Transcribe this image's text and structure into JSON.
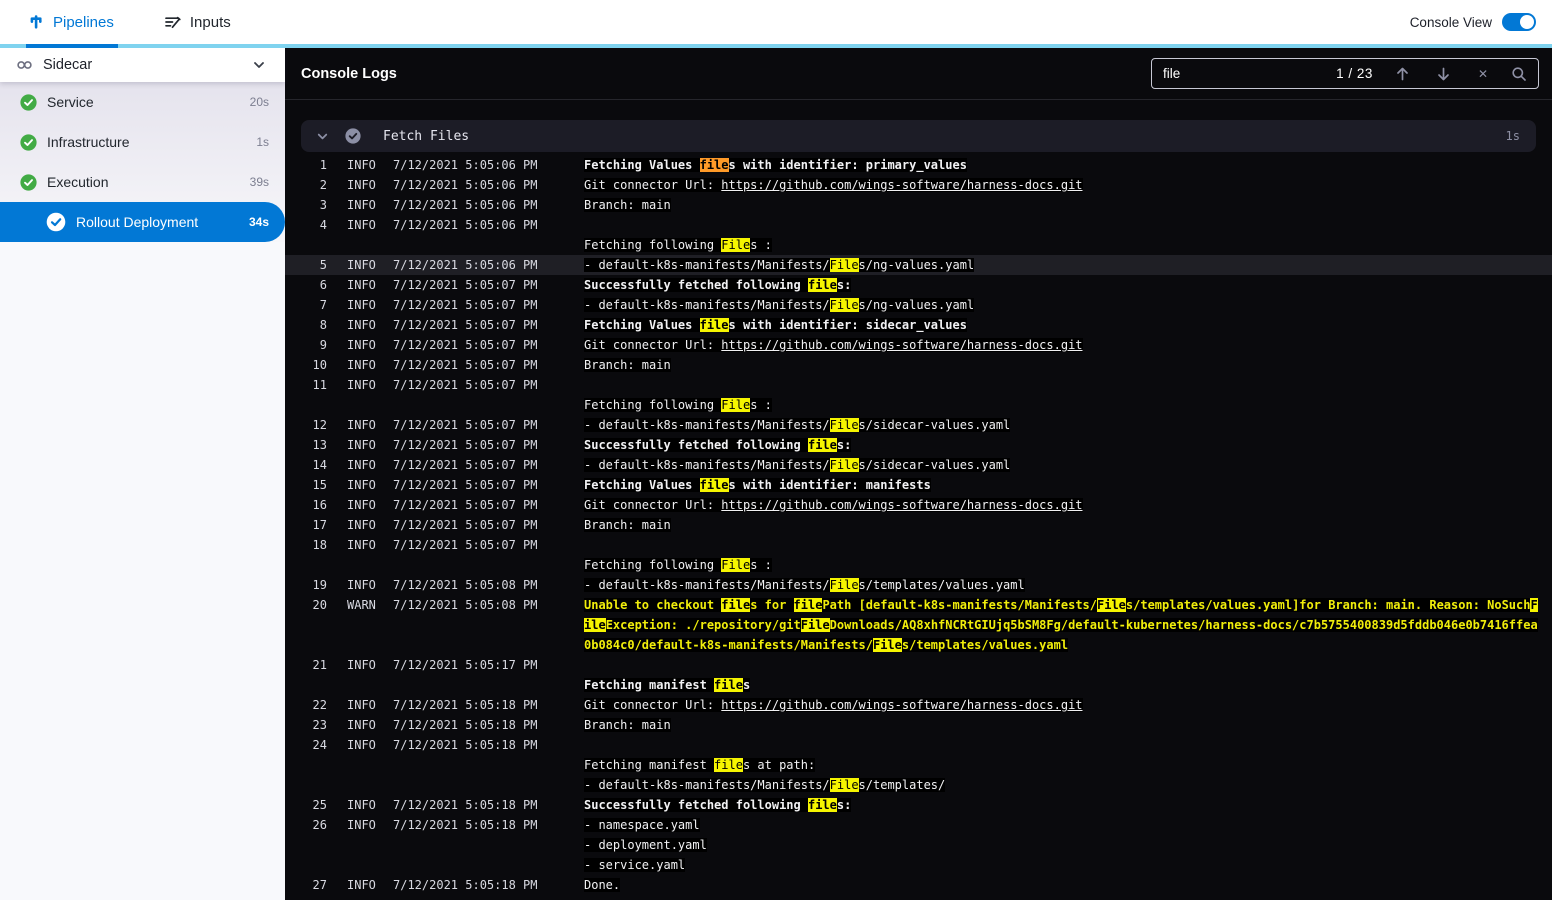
{
  "top_nav": {
    "tabs": [
      {
        "label": "Pipelines",
        "active": true
      },
      {
        "label": "Inputs",
        "active": false
      }
    ],
    "console_view_label": "Console View",
    "console_view_on": true
  },
  "sidebar": {
    "title": "Sidecar",
    "items": [
      {
        "label": "Service",
        "duration": "20s",
        "status": "success",
        "selected": false,
        "indent": false
      },
      {
        "label": "Infrastructure",
        "duration": "1s",
        "status": "success",
        "selected": false,
        "indent": false
      },
      {
        "label": "Execution",
        "duration": "39s",
        "status": "success",
        "selected": false,
        "indent": false
      },
      {
        "label": "Rollout Deployment",
        "duration": "34s",
        "status": "success",
        "selected": true,
        "indent": true
      }
    ]
  },
  "console": {
    "title": "Console Logs",
    "search": {
      "value": "file",
      "counter": "1 / 23"
    },
    "section": {
      "title": "Fetch Files",
      "duration": "1s"
    },
    "entries": [
      {
        "n": 1,
        "l": "INFO",
        "t": "7/12/2021 5:05:06 PM",
        "rows": [
          [
            {
              "x": "Fetching Values ",
              "b": 1
            },
            {
              "x": "file",
              "h": "o",
              "b": 1
            },
            {
              "x": "s with identifier: primary_values",
              "b": 1
            }
          ]
        ]
      },
      {
        "n": 2,
        "l": "INFO",
        "t": "7/12/2021 5:05:06 PM",
        "rows": [
          [
            {
              "x": "Git connector Url: "
            },
            {
              "x": "https://github.com/wings-software/harness-docs.git",
              "u": 1
            }
          ]
        ]
      },
      {
        "n": 3,
        "l": "INFO",
        "t": "7/12/2021 5:05:06 PM",
        "rows": [
          [
            {
              "x": "Branch: main"
            }
          ]
        ]
      },
      {
        "n": 4,
        "l": "INFO",
        "t": "7/12/2021 5:05:06 PM",
        "rows": [
          [],
          [
            {
              "x": "Fetching following "
            },
            {
              "x": "File",
              "h": "y"
            },
            {
              "x": "s :"
            }
          ]
        ]
      },
      {
        "n": 5,
        "l": "INFO",
        "t": "7/12/2021 5:05:06 PM",
        "cur": 1,
        "rows": [
          [
            {
              "x": "- default-k8s-manifests/Manifests/"
            },
            {
              "x": "File",
              "h": "y"
            },
            {
              "x": "s/ng-values.yaml"
            }
          ]
        ]
      },
      {
        "n": 6,
        "l": "INFO",
        "t": "7/12/2021 5:05:07 PM",
        "rows": [
          [
            {
              "x": "Successfully fetched following ",
              "b": 1
            },
            {
              "x": "file",
              "h": "y",
              "b": 1
            },
            {
              "x": "s:",
              "b": 1
            }
          ]
        ]
      },
      {
        "n": 7,
        "l": "INFO",
        "t": "7/12/2021 5:05:07 PM",
        "rows": [
          [
            {
              "x": "- default-k8s-manifests/Manifests/"
            },
            {
              "x": "File",
              "h": "y"
            },
            {
              "x": "s/ng-values.yaml"
            }
          ]
        ]
      },
      {
        "n": 8,
        "l": "INFO",
        "t": "7/12/2021 5:05:07 PM",
        "rows": [
          [
            {
              "x": "Fetching Values ",
              "b": 1
            },
            {
              "x": "file",
              "h": "y",
              "b": 1
            },
            {
              "x": "s with identifier: sidecar_values",
              "b": 1
            }
          ]
        ]
      },
      {
        "n": 9,
        "l": "INFO",
        "t": "7/12/2021 5:05:07 PM",
        "rows": [
          [
            {
              "x": "Git connector Url: "
            },
            {
              "x": "https://github.com/wings-software/harness-docs.git",
              "u": 1
            }
          ]
        ]
      },
      {
        "n": 10,
        "l": "INFO",
        "t": "7/12/2021 5:05:07 PM",
        "rows": [
          [
            {
              "x": "Branch: main"
            }
          ]
        ]
      },
      {
        "n": 11,
        "l": "INFO",
        "t": "7/12/2021 5:05:07 PM",
        "rows": [
          [],
          [
            {
              "x": "Fetching following "
            },
            {
              "x": "File",
              "h": "y"
            },
            {
              "x": "s :"
            }
          ]
        ]
      },
      {
        "n": 12,
        "l": "INFO",
        "t": "7/12/2021 5:05:07 PM",
        "rows": [
          [
            {
              "x": "- default-k8s-manifests/Manifests/"
            },
            {
              "x": "File",
              "h": "y"
            },
            {
              "x": "s/sidecar-values.yaml"
            }
          ]
        ]
      },
      {
        "n": 13,
        "l": "INFO",
        "t": "7/12/2021 5:05:07 PM",
        "rows": [
          [
            {
              "x": "Successfully fetched following ",
              "b": 1
            },
            {
              "x": "file",
              "h": "y",
              "b": 1
            },
            {
              "x": "s:",
              "b": 1
            }
          ]
        ]
      },
      {
        "n": 14,
        "l": "INFO",
        "t": "7/12/2021 5:05:07 PM",
        "rows": [
          [
            {
              "x": "- default-k8s-manifests/Manifests/"
            },
            {
              "x": "File",
              "h": "y"
            },
            {
              "x": "s/sidecar-values.yaml"
            }
          ]
        ]
      },
      {
        "n": 15,
        "l": "INFO",
        "t": "7/12/2021 5:05:07 PM",
        "rows": [
          [
            {
              "x": "Fetching Values ",
              "b": 1
            },
            {
              "x": "file",
              "h": "y",
              "b": 1
            },
            {
              "x": "s with identifier: manifests",
              "b": 1
            }
          ]
        ]
      },
      {
        "n": 16,
        "l": "INFO",
        "t": "7/12/2021 5:05:07 PM",
        "rows": [
          [
            {
              "x": "Git connector Url: "
            },
            {
              "x": "https://github.com/wings-software/harness-docs.git",
              "u": 1
            }
          ]
        ]
      },
      {
        "n": 17,
        "l": "INFO",
        "t": "7/12/2021 5:05:07 PM",
        "rows": [
          [
            {
              "x": "Branch: main"
            }
          ]
        ]
      },
      {
        "n": 18,
        "l": "INFO",
        "t": "7/12/2021 5:05:07 PM",
        "rows": [
          [],
          [
            {
              "x": "Fetching following "
            },
            {
              "x": "File",
              "h": "y"
            },
            {
              "x": "s :"
            }
          ]
        ]
      },
      {
        "n": 19,
        "l": "INFO",
        "t": "7/12/2021 5:05:08 PM",
        "rows": [
          [
            {
              "x": "- default-k8s-manifests/Manifests/"
            },
            {
              "x": "File",
              "h": "y"
            },
            {
              "x": "s/templates/values.yaml"
            }
          ]
        ]
      },
      {
        "n": 20,
        "l": "WARN",
        "t": "7/12/2021 5:05:08 PM",
        "rows": [
          [
            {
              "x": "Unable to checkout ",
              "w": 1
            },
            {
              "x": "file",
              "h": "y",
              "w": 1
            },
            {
              "x": "s for ",
              "w": 1
            },
            {
              "x": "file",
              "h": "y",
              "w": 1
            },
            {
              "x": "Path [default-k8s-manifests/Manifests/",
              "w": 1
            },
            {
              "x": "File",
              "h": "y",
              "w": 1
            },
            {
              "x": "s/templates/values.yaml]for Branch: main. Reason: NoSuch",
              "w": 1
            },
            {
              "x": "File",
              "h": "y",
              "w": 1
            },
            {
              "x": "Exception: ./repository/git",
              "w": 1
            },
            {
              "x": "File",
              "h": "y",
              "w": 1
            },
            {
              "x": "Downloads/AQ8xhfNCRtGIUjq5bSM8Fg/default-kubernetes/harness-docs/c7b5755400839d5fddb046e0b7416ffea0b084c0/default-k8s-manifests/Manifests/",
              "w": 1
            },
            {
              "x": "File",
              "h": "y",
              "w": 1
            },
            {
              "x": "s/templates/values.yaml",
              "w": 1
            }
          ]
        ]
      },
      {
        "n": 21,
        "l": "INFO",
        "t": "7/12/2021 5:05:17 PM",
        "rows": [
          [],
          [
            {
              "x": "Fetching manifest ",
              "b": 1
            },
            {
              "x": "file",
              "h": "y",
              "b": 1
            },
            {
              "x": "s",
              "b": 1
            }
          ]
        ]
      },
      {
        "n": 22,
        "l": "INFO",
        "t": "7/12/2021 5:05:18 PM",
        "rows": [
          [
            {
              "x": "Git connector Url: "
            },
            {
              "x": "https://github.com/wings-software/harness-docs.git",
              "u": 1
            }
          ]
        ]
      },
      {
        "n": 23,
        "l": "INFO",
        "t": "7/12/2021 5:05:18 PM",
        "rows": [
          [
            {
              "x": "Branch: main"
            }
          ]
        ]
      },
      {
        "n": 24,
        "l": "INFO",
        "t": "7/12/2021 5:05:18 PM",
        "rows": [
          [],
          [
            {
              "x": "Fetching manifest "
            },
            {
              "x": "file",
              "h": "y"
            },
            {
              "x": "s at path:"
            }
          ],
          [
            {
              "x": "- default-k8s-manifests/Manifests/"
            },
            {
              "x": "File",
              "h": "y"
            },
            {
              "x": "s/templates/"
            }
          ]
        ]
      },
      {
        "n": 25,
        "l": "INFO",
        "t": "7/12/2021 5:05:18 PM",
        "rows": [
          [
            {
              "x": "Successfully fetched following ",
              "b": 1
            },
            {
              "x": "file",
              "h": "y",
              "b": 1
            },
            {
              "x": "s:",
              "b": 1
            }
          ]
        ]
      },
      {
        "n": 26,
        "l": "INFO",
        "t": "7/12/2021 5:05:18 PM",
        "rows": [
          [
            {
              "x": "- namespace.yaml"
            }
          ],
          [
            {
              "x": "- deployment.yaml"
            }
          ],
          [
            {
              "x": "- service.yaml"
            }
          ]
        ]
      },
      {
        "n": 27,
        "l": "INFO",
        "t": "7/12/2021 5:05:18 PM",
        "rows": [
          [
            {
              "x": "Done."
            }
          ]
        ]
      }
    ]
  },
  "colors": {
    "accent_blue": "#0278d5",
    "cyan_strip": "#7fd3ef",
    "success_green": "#42ab45",
    "highlight_yellow": "#f6f500",
    "current_match_orange": "#ff9a28",
    "warn_text": "#f1ee0b"
  }
}
